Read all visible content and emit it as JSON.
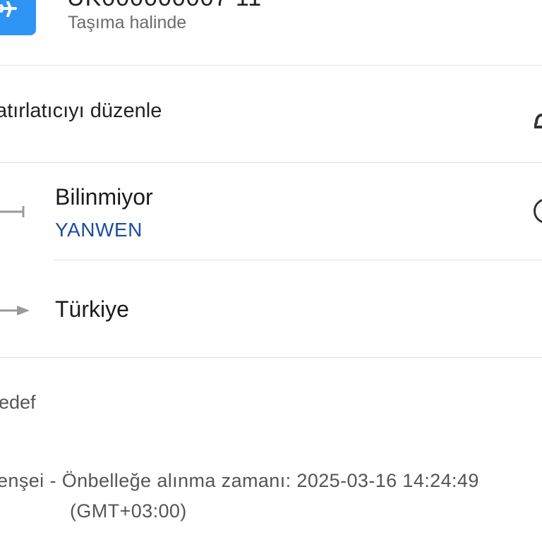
{
  "header": {
    "icon": "airplane-icon",
    "tracking_number": "UK000000007 11",
    "status": "Taşıma halinde",
    "accent_color": "#2f95f5"
  },
  "reminder": {
    "label": "atırlatıcıyı düzenle",
    "icon": "bell-icon"
  },
  "route": {
    "origin": {
      "title": "Bilinmiyor",
      "carrier": "YANWEN",
      "icon": "departure-line-icon",
      "action_icon": "help-circle-icon"
    },
    "destination": {
      "title": "Türkiye",
      "icon": "arrival-arrow-icon"
    },
    "carrier_color": "#1d4e9c"
  },
  "sections": {
    "target_label": "edef"
  },
  "footer": {
    "cache_line1": "enşei - Önbelleğe alınma zamanı: 2025-03-16 14:24:49",
    "cache_line2": "(GMT+03:00)"
  }
}
